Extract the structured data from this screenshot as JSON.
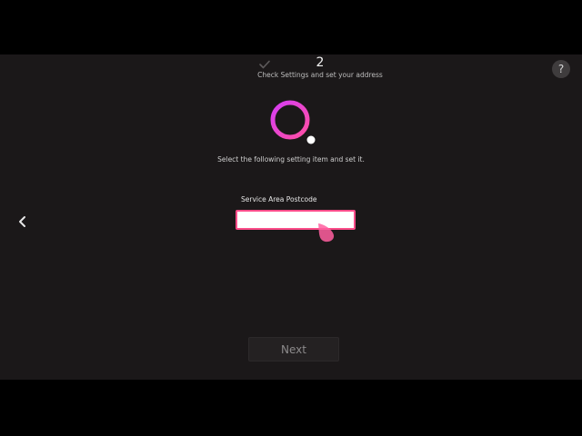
{
  "wizard": {
    "step_number": "2",
    "step_caption": "Check Settings and set your address",
    "completed_step_icon": "check-icon"
  },
  "help": {
    "label": "?",
    "icon": "help-icon"
  },
  "loader": {
    "icon": "spinner-icon",
    "colors": [
      "#e040fb",
      "#ff4fa3"
    ]
  },
  "instruction": "Select the following setting item and set it.",
  "postcode": {
    "label": "Service Area Postcode",
    "value": "",
    "placeholder": "",
    "focus_color": "#ff4d8a"
  },
  "navigation": {
    "back_icon": "chevron-left-icon",
    "next_label": "Next"
  },
  "cursor": {
    "icon": "magic-remote-pointer-icon",
    "color": "#ff5fa0"
  }
}
